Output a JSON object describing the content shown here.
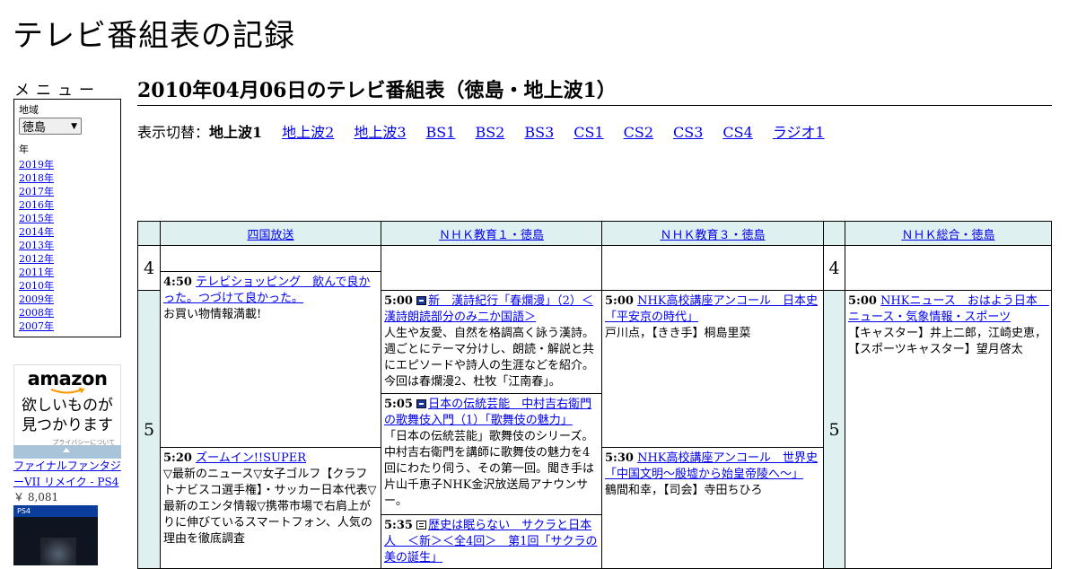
{
  "site_title": "テレビ番組表の記録",
  "menu": {
    "title": "メニュー",
    "region_label": "地域",
    "region_value": "徳島",
    "year_label": "年",
    "years": [
      "2019年",
      "2018年",
      "2017年",
      "2016年",
      "2015年",
      "2014年",
      "2013年",
      "2012年",
      "2011年",
      "2010年",
      "2009年",
      "2008年",
      "2007年"
    ]
  },
  "ad": {
    "logo": "amazon",
    "tagline_1": "欲しいものが",
    "tagline_2": "見つかります",
    "privacy": "プライバシーについて",
    "product_title": "ファイナルファンタジーVII リメイク - PS4",
    "product_price": "￥ 8,081",
    "product_badge": "PS4"
  },
  "page_heading": "2010年04月06日のテレビ番組表（徳島・地上波1）",
  "switcher": {
    "label": "表示切替：",
    "current": "地上波1",
    "links": [
      "地上波2",
      "地上波3",
      "BS1",
      "BS2",
      "BS3",
      "CS1",
      "CS2",
      "CS3",
      "CS4",
      "ラジオ1"
    ]
  },
  "grid": {
    "channels": [
      "四国放送",
      "ＮＨＫ教育１・徳島",
      "ＮＨＫ教育３・徳島",
      "ＮＨＫ総合・徳島"
    ],
    "hours": [
      "4",
      "5"
    ],
    "programs": {
      "ch1_p1": {
        "time": "4:50",
        "title": "テレビショッピング　飲んで良かった。つづけて良かった。",
        "desc": "お買い物情報満載!"
      },
      "ch1_p2": {
        "time": "5:20",
        "title": "ズームイン!!SUPER",
        "desc": "▽最新のニュース▽女子ゴルフ【クラフトナビスコ選手権】・サッカー日本代表▽最新のエンタ情報▽携帯市場で右肩上がりに伸びているスマートフォン、人気の理由を徹底調査"
      },
      "ch2_p1": {
        "time": "5:00",
        "title": "新　漢詩紀行「春爛漫」（2）＜漢詩朗読部分のみ二か国語＞",
        "desc": "人生や友愛、自然を格調高く詠う漢詩。週ごとにテーマ分けし、朗読・解説と共にエピソードや詩人の生涯などを紹介。今回は春爛漫2、杜牧「江南春」。"
      },
      "ch2_p2": {
        "time": "5:05",
        "title": "日本の伝統芸能　中村吉右衛門の歌舞伎入門（1）「歌舞伎の魅力」",
        "desc": "「日本の伝統芸能」歌舞伎のシリーズ。中村吉右衛門を講師に歌舞伎の魅力を4回にわたり伺う、その第一回。聞き手は片山千恵子NHK金沢放送局アナウンサー。"
      },
      "ch2_p3": {
        "time": "5:35",
        "title": "歴史は眠らない　サクラと日本人　＜新＞＜全4回＞　第1回「サクラの美の誕生」",
        "desc": ""
      },
      "ch3_p1": {
        "time": "5:00",
        "title": "NHK高校講座アンコール　日本史「平安京の時代」",
        "desc": "戸川点，【きき手】桐島里菜"
      },
      "ch3_p2": {
        "time": "5:30",
        "title": "NHK高校講座アンコール　世界史「中国文明～殷墟から始皇帝陵へ～」",
        "desc": "鶴間和幸，【司会】寺田ちひろ"
      },
      "ch4_p1": {
        "time": "5:00",
        "title": "NHKニュース　おはよう日本　ニュース・気象情報・スポーツ",
        "desc": "【キャスター】井上二郎，江崎史恵，【スポーツキャスター】望月啓太"
      }
    }
  }
}
